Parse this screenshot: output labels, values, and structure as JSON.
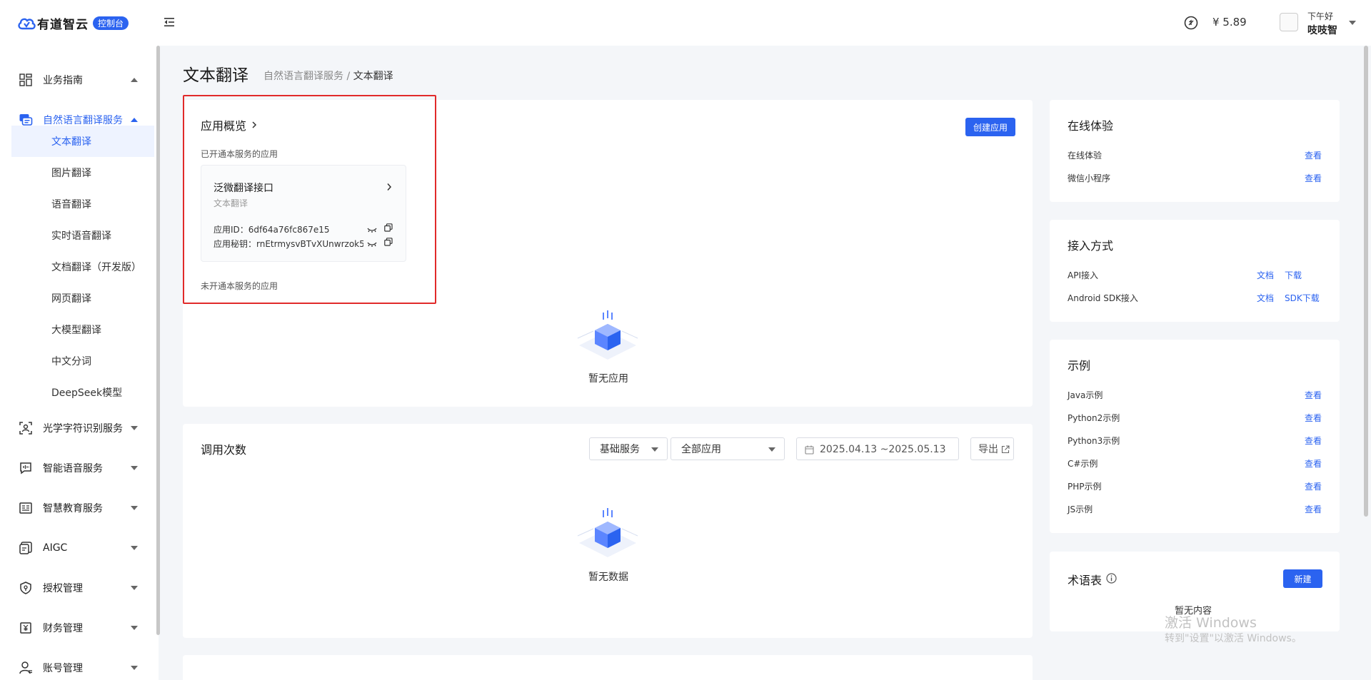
{
  "header": {
    "logo_text": "有道智云",
    "badge": "控制台",
    "balance": "¥ 5.89",
    "greeting": "下午好",
    "username": "吱吱智"
  },
  "sidebar": {
    "groups": [
      {
        "label": "业务指南",
        "icon": "grid-icon",
        "expanded": true
      },
      {
        "label": "自然语言翻译服务",
        "icon": "chat-translate-icon",
        "expanded": true,
        "active": true
      },
      {
        "label": "光学字符识别服务",
        "icon": "scan-icon",
        "expanded": false
      },
      {
        "label": "智能语音服务",
        "icon": "voice-icon",
        "expanded": false
      },
      {
        "label": "智慧教育服务",
        "icon": "education-icon",
        "expanded": false
      },
      {
        "label": "AIGC",
        "icon": "aigc-icon",
        "expanded": false
      },
      {
        "label": "授权管理",
        "icon": "shield-icon",
        "expanded": false
      },
      {
        "label": "财务管理",
        "icon": "finance-icon",
        "expanded": false
      },
      {
        "label": "账号管理",
        "icon": "user-icon",
        "expanded": false
      }
    ],
    "sub_items": [
      {
        "label": "文本翻译",
        "active": true
      },
      {
        "label": "图片翻译"
      },
      {
        "label": "语音翻译"
      },
      {
        "label": "实时语音翻译"
      },
      {
        "label": "文档翻译（开发版）"
      },
      {
        "label": "网页翻译"
      },
      {
        "label": "大模型翻译"
      },
      {
        "label": "中文分词"
      },
      {
        "label": "DeepSeek模型"
      }
    ]
  },
  "page": {
    "title": "文本翻译",
    "breadcrumb_parent": "自然语言翻译服务",
    "breadcrumb_sep": " / ",
    "breadcrumb_current": "文本翻译"
  },
  "overview": {
    "title": "应用概览",
    "create_button": "创建应用",
    "enabled_label": "已开通本服务的应用",
    "app": {
      "name": "泛微翻译接口",
      "type": "文本翻译",
      "id_label": "应用ID：",
      "id_value": "6df64a76fc867e15",
      "secret_label": "应用秘钥：",
      "secret_value": "rnEtrmysvBTvXUnwrzok5..."
    },
    "disabled_label": "未开通本服务的应用",
    "empty_text": "暂无应用"
  },
  "calls": {
    "title": "调用次数",
    "service_select": "基础服务",
    "app_select": "全部应用",
    "date_range": "2025.04.13 ~2025.05.13",
    "export_label": "导出",
    "empty_text": "暂无数据"
  },
  "online": {
    "title": "在线体验",
    "rows": [
      {
        "label": "在线体验",
        "link": "查看"
      },
      {
        "label": "微信小程序",
        "link": "查看"
      }
    ]
  },
  "access": {
    "title": "接入方式",
    "rows": [
      {
        "label": "API接入",
        "link1": "文档",
        "link2": "下载"
      },
      {
        "label": "Android SDK接入",
        "link1": "文档",
        "link2": "SDK下载"
      }
    ]
  },
  "examples": {
    "title": "示例",
    "rows": [
      {
        "label": "Java示例",
        "link": "查看"
      },
      {
        "label": "Python2示例",
        "link": "查看"
      },
      {
        "label": "Python3示例",
        "link": "查看"
      },
      {
        "label": "C#示例",
        "link": "查看"
      },
      {
        "label": "PHP示例",
        "link": "查看"
      },
      {
        "label": "JS示例",
        "link": "查看"
      }
    ]
  },
  "glossary": {
    "title": "术语表",
    "new_button": "新建",
    "empty_text": "暂无内容"
  },
  "watermark": {
    "line1": "激活 Windows",
    "line2": "转到\"设置\"以激活 Windows。"
  },
  "colors": {
    "primary": "#2b63f0",
    "highlight": "#e12a2a",
    "background": "#f4f6f9"
  }
}
